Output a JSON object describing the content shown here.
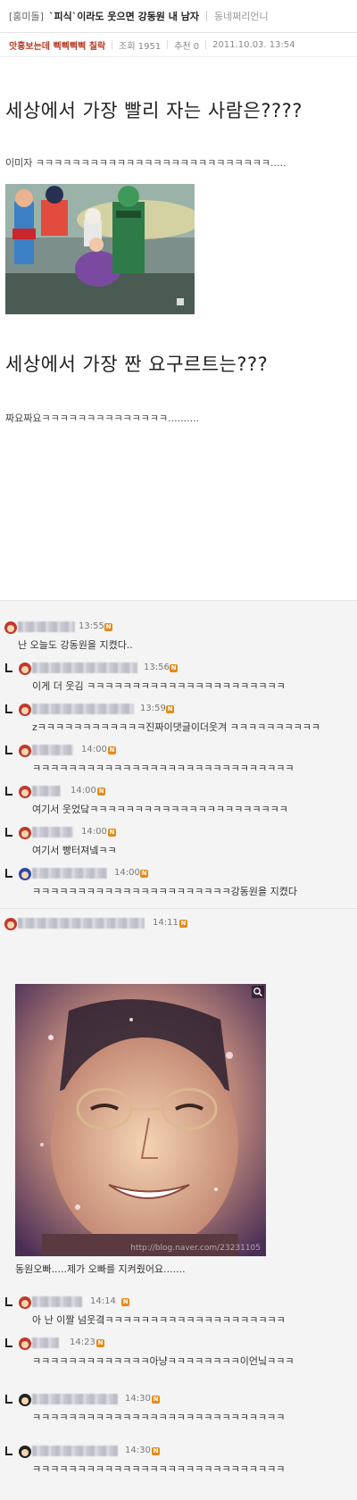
{
  "header": {
    "category": "[홍미돌]",
    "title": "`피식`이라도 웃으면 강동원 내 남자",
    "author": "동네쩌리언니"
  },
  "meta": {
    "subject": "앗홍보는데 삑삑삑삑 칠락",
    "views": "조회 1951",
    "recommend": "추천 0",
    "datetime": "2011.10.03. 13:54"
  },
  "post": {
    "q1": "세상에서 가장 빨리 자는 사람은????",
    "a1": "이미자 ㅋㅋㅋㅋㅋㅋㅋㅋㅋㅋㅋㅋㅋㅋㅋㅋㅋㅋㅋㅋㅋㅋㅋㅋㅋㅋ.....",
    "q2": "세상에서 가장 짠 요구르트는???",
    "a2": "짜요짜요ㅋㅋㅋㅋㅋㅋㅋㅋㅋㅋㅋㅋㅋㅋ.........."
  },
  "comments": [
    {
      "time": "13:55",
      "text": "난 오늘도 강동원을 지켰다..",
      "reply": false
    },
    {
      "time": "13:56",
      "text": "이게 더 웃김 ㅋㅋㅋㅋㅋㅋㅋㅋㅋㅋㅋㅋㅋㅋㅋㅋㅋㅋㅋㅋㅋㅋ",
      "reply": true
    },
    {
      "time": "13:59",
      "text": "zㅋㅋㅋㅋㅋㅋㅋㅋㅋㅋㅋㅋ진짜이댓글이더웃겨 ㅋㅋㅋㅋㅋㅋㅋㅋㅋㅋ",
      "reply": true
    },
    {
      "time": "14:00",
      "text": "ㅋㅋㅋㅋㅋㅋㅋㅋㅋㅋㅋㅋㅋㅋㅋㅋㅋㅋㅋㅋㅋㅋㅋㅋㅋㅋㅋㅋㅋ",
      "reply": true
    },
    {
      "time": "14:00",
      "text": "여기서 웃었닼ㅋㅋㅋㅋㅋㅋㅋㅋㅋㅋㅋㅋㅋㅋㅋㅋㅋㅋㅋㅋㅋㅋ",
      "reply": true
    },
    {
      "time": "14:00",
      "text": "여기서 빵터져넼ㅋㅋ",
      "reply": true
    },
    {
      "time": "14:00",
      "text": "ㅋㅋㅋㅋㅋㅋㅋㅋㅋㅋㅋㅋㅋㅋㅋㅋㅋㅋㅋㅋㅋㅋ강동원을 지켰다",
      "reply": true
    },
    {
      "time": "14:11",
      "text": "동원오빠.....제가 오빠를 지켜줬어요.......",
      "reply": false,
      "photo_watermark": "http://blog.naver.com/23231105"
    },
    {
      "time": "14:14",
      "text": "아 난 이짤 넘웃곀ㅋㅋㅋㅋㅋㅋㅋㅋㅋㅋㅋㅋㅋㅋㅋㅋㅋㅋㅋㅋ",
      "reply": true
    },
    {
      "time": "14:23",
      "text": "ㅋㅋㅋㅋㅋㅋㅋㅋㅋㅋㅋㅋㅋ아냥ㅋㅋㅋㅋㅋㅋㅋㅋ이언닠ㅋㅋㅋ",
      "reply": true
    },
    {
      "time": "14:30",
      "text": "ㅋㅋㅋㅋㅋㅋㅋㅋㅋㅋㅋㅋㅋㅋㅋㅋㅋㅋㅋㅋㅋㅋㅋㅋㅋㅋㅋㅋ",
      "reply": true
    },
    {
      "time": "14:30",
      "text": "ㅋㅋㅋㅋㅋㅋㅋㅋㅋㅋㅋㅋㅋㅋㅋㅋㅋㅋㅋㅋㅋㅋㅋㅋㅋㅋㅋㅋ",
      "reply": true
    }
  ],
  "badge_letter": "N"
}
